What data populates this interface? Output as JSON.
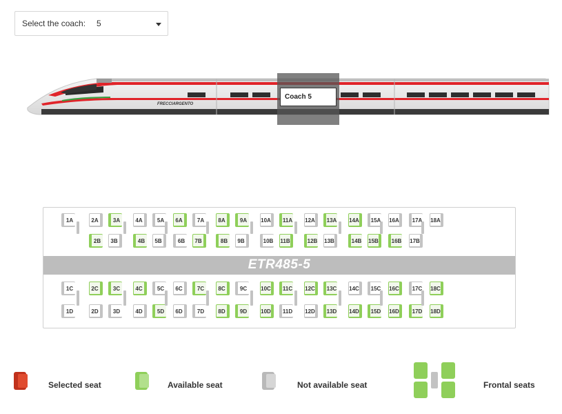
{
  "coach_select": {
    "label": "Select the coach:",
    "value": "5"
  },
  "train": {
    "brand": "FRECCIARGENTO",
    "coach_label": "Coach 5"
  },
  "seatmap": {
    "band_label": "ETR485-5",
    "upper_row1": [
      {
        "id": "1A",
        "status": "na"
      },
      {
        "id": "2A",
        "status": "na"
      },
      {
        "id": "3A",
        "status": "av"
      },
      {
        "id": "4A",
        "status": "na"
      },
      {
        "id": "5A",
        "status": "na"
      },
      {
        "id": "6A",
        "status": "av"
      },
      {
        "id": "7A",
        "status": "na"
      },
      {
        "id": "8A",
        "status": "av"
      },
      {
        "id": "9A",
        "status": "av"
      },
      {
        "id": "10A",
        "status": "na"
      },
      {
        "id": "11A",
        "status": "av"
      },
      {
        "id": "12A",
        "status": "na"
      },
      {
        "id": "13A",
        "status": "av"
      },
      {
        "id": "14A",
        "status": "av"
      },
      {
        "id": "15A",
        "status": "na"
      },
      {
        "id": "16A",
        "status": "na"
      },
      {
        "id": "17A",
        "status": "na"
      },
      {
        "id": "18A",
        "status": "na"
      }
    ],
    "upper_row2": [
      {
        "id": "2B",
        "status": "av"
      },
      {
        "id": "3B",
        "status": "na"
      },
      {
        "id": "4B",
        "status": "av"
      },
      {
        "id": "5B",
        "status": "na"
      },
      {
        "id": "6B",
        "status": "na"
      },
      {
        "id": "7B",
        "status": "av"
      },
      {
        "id": "8B",
        "status": "av"
      },
      {
        "id": "9B",
        "status": "na"
      },
      {
        "id": "10B",
        "status": "na"
      },
      {
        "id": "11B",
        "status": "av"
      },
      {
        "id": "12B",
        "status": "av"
      },
      {
        "id": "13B",
        "status": "na"
      },
      {
        "id": "14B",
        "status": "av"
      },
      {
        "id": "15B",
        "status": "av"
      },
      {
        "id": "16B",
        "status": "av"
      },
      {
        "id": "17B",
        "status": "na"
      }
    ],
    "lower_row1": [
      {
        "id": "1C",
        "status": "na"
      },
      {
        "id": "2C",
        "status": "av"
      },
      {
        "id": "3C",
        "status": "av"
      },
      {
        "id": "4C",
        "status": "av"
      },
      {
        "id": "5C",
        "status": "na"
      },
      {
        "id": "6C",
        "status": "na"
      },
      {
        "id": "7C",
        "status": "av"
      },
      {
        "id": "8C",
        "status": "av"
      },
      {
        "id": "9C",
        "status": "na"
      },
      {
        "id": "10C",
        "status": "av"
      },
      {
        "id": "11C",
        "status": "av"
      },
      {
        "id": "12C",
        "status": "av"
      },
      {
        "id": "13C",
        "status": "av"
      },
      {
        "id": "14C",
        "status": "na"
      },
      {
        "id": "15C",
        "status": "na"
      },
      {
        "id": "16C",
        "status": "av"
      },
      {
        "id": "17C",
        "status": "na"
      },
      {
        "id": "18C",
        "status": "av"
      }
    ],
    "lower_row2": [
      {
        "id": "1D",
        "status": "na"
      },
      {
        "id": "2D",
        "status": "na"
      },
      {
        "id": "3D",
        "status": "na"
      },
      {
        "id": "4D",
        "status": "na"
      },
      {
        "id": "5D",
        "status": "av"
      },
      {
        "id": "6D",
        "status": "na"
      },
      {
        "id": "7D",
        "status": "na"
      },
      {
        "id": "8D",
        "status": "av"
      },
      {
        "id": "9D",
        "status": "av"
      },
      {
        "id": "10D",
        "status": "av"
      },
      {
        "id": "11D",
        "status": "na"
      },
      {
        "id": "12D",
        "status": "na"
      },
      {
        "id": "13D",
        "status": "av"
      },
      {
        "id": "14D",
        "status": "av"
      },
      {
        "id": "15D",
        "status": "av"
      },
      {
        "id": "16D",
        "status": "av"
      },
      {
        "id": "17D",
        "status": "av"
      },
      {
        "id": "18D",
        "status": "av"
      }
    ]
  },
  "legend": {
    "selected": "Selected seat",
    "available": "Available seat",
    "not_available": "Not available seat",
    "frontal": "Frontal seats"
  },
  "colors": {
    "selected": "#c0311c",
    "available": "#8fcf5a",
    "not_available": "#c3c3c3",
    "train_red": "#e0242a"
  }
}
